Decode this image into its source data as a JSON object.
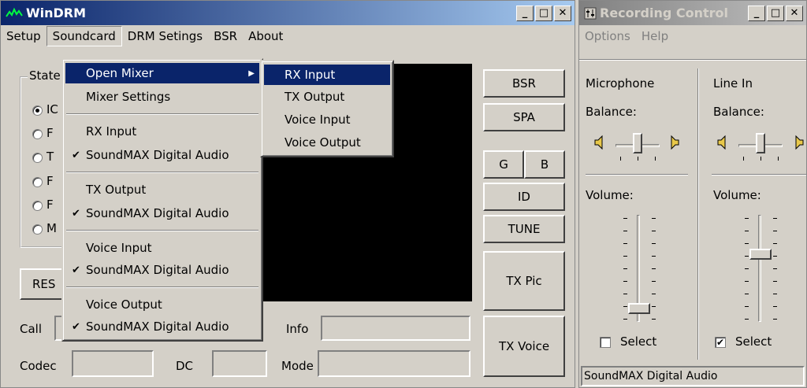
{
  "wdrm": {
    "title": "WinDRM",
    "menu": [
      "Setup",
      "Soundcard",
      "DRM Setings",
      "BSR",
      "About"
    ],
    "state_label": "State",
    "reset_label": "RES",
    "buttons": {
      "bsr": "BSR",
      "spa": "SPA",
      "g": "G",
      "b": "B",
      "id": "ID",
      "tune": "TUNE",
      "tx_pic": "TX Pic",
      "tx_voice": "TX Voice"
    },
    "fields": {
      "call": "Call",
      "info": "Info",
      "codec": "Codec",
      "dc": "DC",
      "mode": "Mode"
    },
    "radio_stubs": [
      "IC",
      "F",
      "T",
      "F",
      "F",
      "M"
    ]
  },
  "soundcard_menu": {
    "items": [
      {
        "label": "Open Mixer",
        "highlighted": true,
        "submenu": true
      },
      {
        "label": "Mixer Settings"
      },
      {
        "label": "RX Input"
      },
      {
        "label": "SoundMAX Digital Audio",
        "checked": true
      },
      {
        "label": "TX Output"
      },
      {
        "label": "SoundMAX Digital Audio",
        "checked": true
      },
      {
        "label": "Voice Input"
      },
      {
        "label": "SoundMAX Digital Audio",
        "checked": true
      },
      {
        "label": "Voice Output"
      },
      {
        "label": "SoundMAX Digital Audio",
        "checked": true
      }
    ],
    "check_glyph": "✔"
  },
  "mixer_submenu": {
    "items": [
      {
        "label": "RX Input",
        "highlighted": true
      },
      {
        "label": "TX Output"
      },
      {
        "label": "Voice Input"
      },
      {
        "label": "Voice Output"
      }
    ]
  },
  "recording": {
    "title": "Recording Control",
    "menu": [
      "Options",
      "Help"
    ],
    "channels": [
      {
        "name": "Microphone",
        "balance": "Balance:",
        "volume": "Volume:",
        "select": "Select",
        "selected": false,
        "volume_level": 0.08
      },
      {
        "name": "Line In",
        "balance": "Balance:",
        "volume": "Volume:",
        "select": "Select",
        "selected": true,
        "volume_level": 0.65
      }
    ],
    "status": "SoundMAX Digital Audio"
  },
  "colors": {
    "title_active": "#0a246a",
    "highlight": "#0a246a",
    "face": "#d4d0c8",
    "display": "#000000"
  }
}
